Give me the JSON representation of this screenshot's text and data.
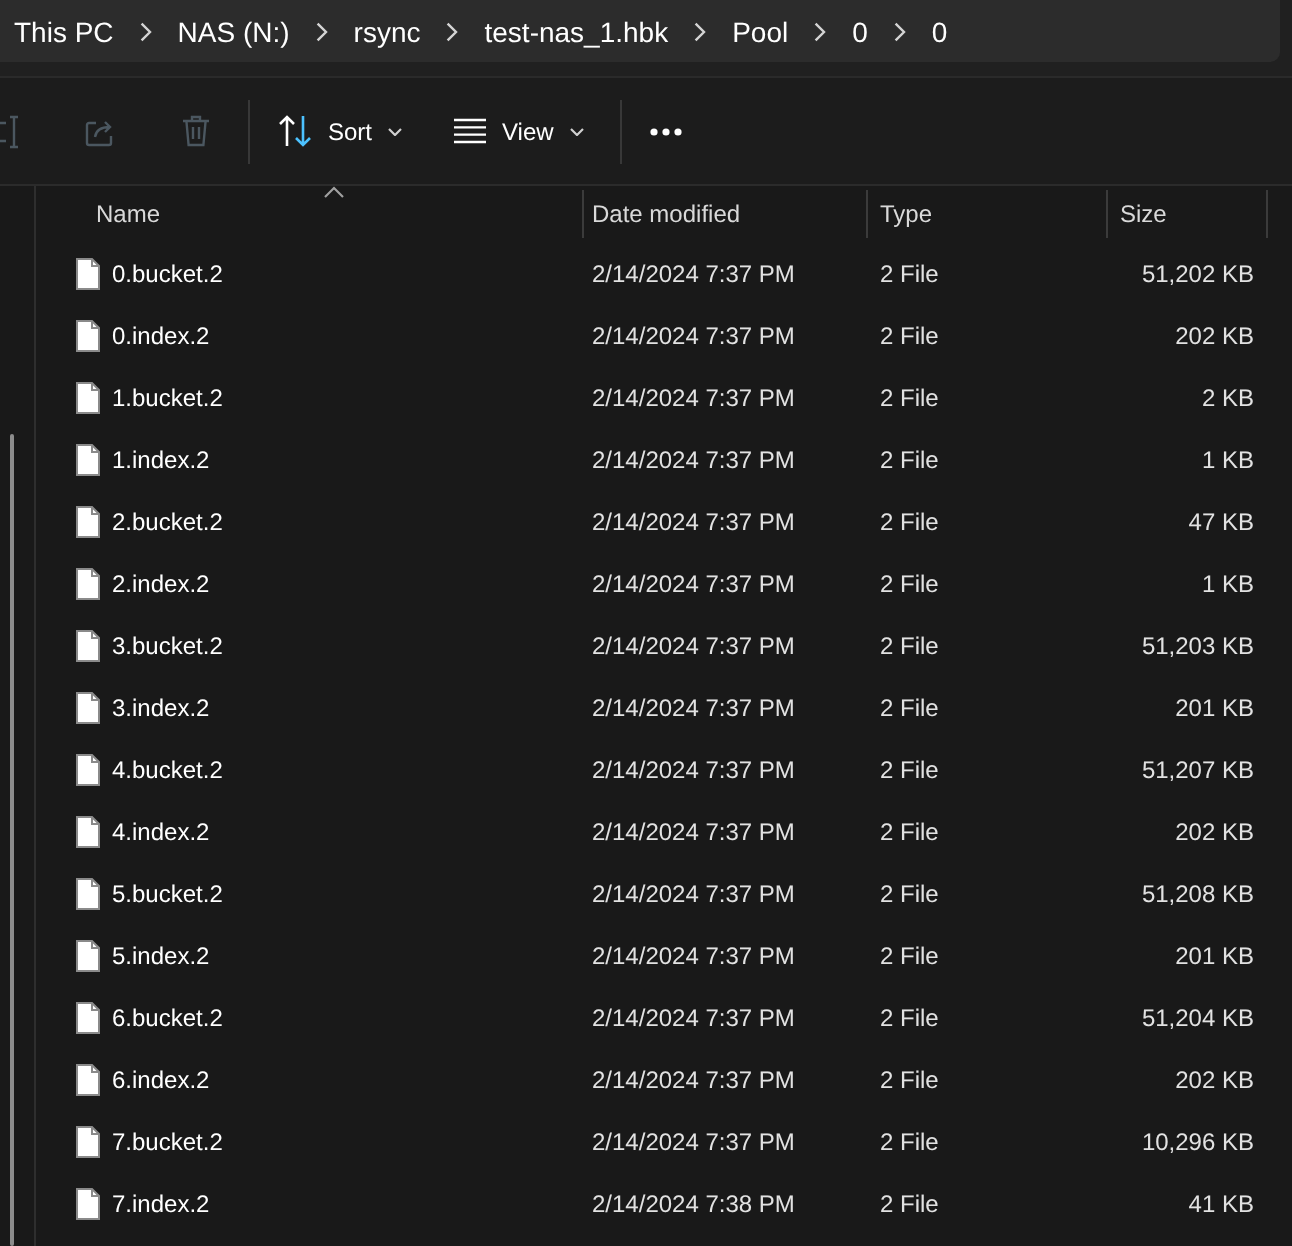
{
  "address_bar": {
    "breadcrumb": [
      "This PC",
      "NAS (N:)",
      "rsync",
      "test-nas_1.hbk",
      "Pool",
      "0",
      "0"
    ]
  },
  "toolbar": {
    "groups": [
      {
        "items": [
          {
            "kind": "rename",
            "disabled": true,
            "dropdown": false
          },
          {
            "kind": "share",
            "disabled": true,
            "dropdown": false
          },
          {
            "kind": "delete",
            "disabled": true,
            "dropdown": false
          }
        ]
      },
      {
        "items": [
          {
            "kind": "sort",
            "label": "Sort",
            "disabled": false,
            "dropdown": true
          },
          {
            "kind": "view",
            "label": "View",
            "disabled": false,
            "dropdown": true
          }
        ]
      },
      {
        "items": [
          {
            "kind": "more",
            "disabled": false,
            "dropdown": false
          }
        ]
      }
    ]
  },
  "columns": [
    {
      "label": "Name",
      "sorted": true
    },
    {
      "label": "Date modified",
      "sorted": false
    },
    {
      "label": "Type",
      "sorted": false
    },
    {
      "label": "Size",
      "sorted": false
    }
  ],
  "files": [
    {
      "name": "0.bucket.2",
      "date_modified": "2/14/2024 7:37 PM",
      "type": "2 File",
      "size": "51,202 KB"
    },
    {
      "name": "0.index.2",
      "date_modified": "2/14/2024 7:37 PM",
      "type": "2 File",
      "size": "202 KB"
    },
    {
      "name": "1.bucket.2",
      "date_modified": "2/14/2024 7:37 PM",
      "type": "2 File",
      "size": "2 KB"
    },
    {
      "name": "1.index.2",
      "date_modified": "2/14/2024 7:37 PM",
      "type": "2 File",
      "size": "1 KB"
    },
    {
      "name": "2.bucket.2",
      "date_modified": "2/14/2024 7:37 PM",
      "type": "2 File",
      "size": "47 KB"
    },
    {
      "name": "2.index.2",
      "date_modified": "2/14/2024 7:37 PM",
      "type": "2 File",
      "size": "1 KB"
    },
    {
      "name": "3.bucket.2",
      "date_modified": "2/14/2024 7:37 PM",
      "type": "2 File",
      "size": "51,203 KB"
    },
    {
      "name": "3.index.2",
      "date_modified": "2/14/2024 7:37 PM",
      "type": "2 File",
      "size": "201 KB"
    },
    {
      "name": "4.bucket.2",
      "date_modified": "2/14/2024 7:37 PM",
      "type": "2 File",
      "size": "51,207 KB"
    },
    {
      "name": "4.index.2",
      "date_modified": "2/14/2024 7:37 PM",
      "type": "2 File",
      "size": "202 KB"
    },
    {
      "name": "5.bucket.2",
      "date_modified": "2/14/2024 7:37 PM",
      "type": "2 File",
      "size": "51,208 KB"
    },
    {
      "name": "5.index.2",
      "date_modified": "2/14/2024 7:37 PM",
      "type": "2 File",
      "size": "201 KB"
    },
    {
      "name": "6.bucket.2",
      "date_modified": "2/14/2024 7:37 PM",
      "type": "2 File",
      "size": "51,204 KB"
    },
    {
      "name": "6.index.2",
      "date_modified": "2/14/2024 7:37 PM",
      "type": "2 File",
      "size": "202 KB"
    },
    {
      "name": "7.bucket.2",
      "date_modified": "2/14/2024 7:37 PM",
      "type": "2 File",
      "size": "10,296 KB"
    },
    {
      "name": "7.index.2",
      "date_modified": "2/14/2024 7:38 PM",
      "type": "2 File",
      "size": "41 KB"
    }
  ]
}
